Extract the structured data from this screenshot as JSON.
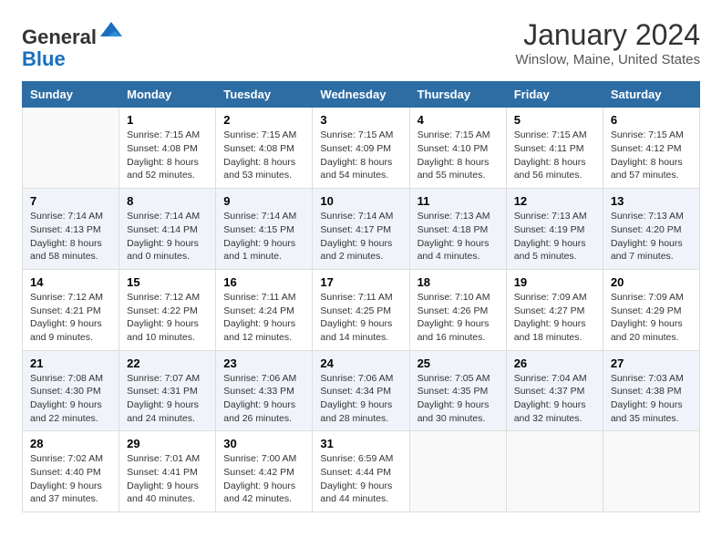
{
  "header": {
    "logo_general": "General",
    "logo_blue": "Blue",
    "month_title": "January 2024",
    "location": "Winslow, Maine, United States"
  },
  "days_of_week": [
    "Sunday",
    "Monday",
    "Tuesday",
    "Wednesday",
    "Thursday",
    "Friday",
    "Saturday"
  ],
  "weeks": [
    [
      {
        "day": "",
        "sunrise": "",
        "sunset": "",
        "daylight": ""
      },
      {
        "day": "1",
        "sunrise": "Sunrise: 7:15 AM",
        "sunset": "Sunset: 4:08 PM",
        "daylight": "Daylight: 8 hours and 52 minutes."
      },
      {
        "day": "2",
        "sunrise": "Sunrise: 7:15 AM",
        "sunset": "Sunset: 4:08 PM",
        "daylight": "Daylight: 8 hours and 53 minutes."
      },
      {
        "day": "3",
        "sunrise": "Sunrise: 7:15 AM",
        "sunset": "Sunset: 4:09 PM",
        "daylight": "Daylight: 8 hours and 54 minutes."
      },
      {
        "day": "4",
        "sunrise": "Sunrise: 7:15 AM",
        "sunset": "Sunset: 4:10 PM",
        "daylight": "Daylight: 8 hours and 55 minutes."
      },
      {
        "day": "5",
        "sunrise": "Sunrise: 7:15 AM",
        "sunset": "Sunset: 4:11 PM",
        "daylight": "Daylight: 8 hours and 56 minutes."
      },
      {
        "day": "6",
        "sunrise": "Sunrise: 7:15 AM",
        "sunset": "Sunset: 4:12 PM",
        "daylight": "Daylight: 8 hours and 57 minutes."
      }
    ],
    [
      {
        "day": "7",
        "sunrise": "Sunrise: 7:14 AM",
        "sunset": "Sunset: 4:13 PM",
        "daylight": "Daylight: 8 hours and 58 minutes."
      },
      {
        "day": "8",
        "sunrise": "Sunrise: 7:14 AM",
        "sunset": "Sunset: 4:14 PM",
        "daylight": "Daylight: 9 hours and 0 minutes."
      },
      {
        "day": "9",
        "sunrise": "Sunrise: 7:14 AM",
        "sunset": "Sunset: 4:15 PM",
        "daylight": "Daylight: 9 hours and 1 minute."
      },
      {
        "day": "10",
        "sunrise": "Sunrise: 7:14 AM",
        "sunset": "Sunset: 4:17 PM",
        "daylight": "Daylight: 9 hours and 2 minutes."
      },
      {
        "day": "11",
        "sunrise": "Sunrise: 7:13 AM",
        "sunset": "Sunset: 4:18 PM",
        "daylight": "Daylight: 9 hours and 4 minutes."
      },
      {
        "day": "12",
        "sunrise": "Sunrise: 7:13 AM",
        "sunset": "Sunset: 4:19 PM",
        "daylight": "Daylight: 9 hours and 5 minutes."
      },
      {
        "day": "13",
        "sunrise": "Sunrise: 7:13 AM",
        "sunset": "Sunset: 4:20 PM",
        "daylight": "Daylight: 9 hours and 7 minutes."
      }
    ],
    [
      {
        "day": "14",
        "sunrise": "Sunrise: 7:12 AM",
        "sunset": "Sunset: 4:21 PM",
        "daylight": "Daylight: 9 hours and 9 minutes."
      },
      {
        "day": "15",
        "sunrise": "Sunrise: 7:12 AM",
        "sunset": "Sunset: 4:22 PM",
        "daylight": "Daylight: 9 hours and 10 minutes."
      },
      {
        "day": "16",
        "sunrise": "Sunrise: 7:11 AM",
        "sunset": "Sunset: 4:24 PM",
        "daylight": "Daylight: 9 hours and 12 minutes."
      },
      {
        "day": "17",
        "sunrise": "Sunrise: 7:11 AM",
        "sunset": "Sunset: 4:25 PM",
        "daylight": "Daylight: 9 hours and 14 minutes."
      },
      {
        "day": "18",
        "sunrise": "Sunrise: 7:10 AM",
        "sunset": "Sunset: 4:26 PM",
        "daylight": "Daylight: 9 hours and 16 minutes."
      },
      {
        "day": "19",
        "sunrise": "Sunrise: 7:09 AM",
        "sunset": "Sunset: 4:27 PM",
        "daylight": "Daylight: 9 hours and 18 minutes."
      },
      {
        "day": "20",
        "sunrise": "Sunrise: 7:09 AM",
        "sunset": "Sunset: 4:29 PM",
        "daylight": "Daylight: 9 hours and 20 minutes."
      }
    ],
    [
      {
        "day": "21",
        "sunrise": "Sunrise: 7:08 AM",
        "sunset": "Sunset: 4:30 PM",
        "daylight": "Daylight: 9 hours and 22 minutes."
      },
      {
        "day": "22",
        "sunrise": "Sunrise: 7:07 AM",
        "sunset": "Sunset: 4:31 PM",
        "daylight": "Daylight: 9 hours and 24 minutes."
      },
      {
        "day": "23",
        "sunrise": "Sunrise: 7:06 AM",
        "sunset": "Sunset: 4:33 PM",
        "daylight": "Daylight: 9 hours and 26 minutes."
      },
      {
        "day": "24",
        "sunrise": "Sunrise: 7:06 AM",
        "sunset": "Sunset: 4:34 PM",
        "daylight": "Daylight: 9 hours and 28 minutes."
      },
      {
        "day": "25",
        "sunrise": "Sunrise: 7:05 AM",
        "sunset": "Sunset: 4:35 PM",
        "daylight": "Daylight: 9 hours and 30 minutes."
      },
      {
        "day": "26",
        "sunrise": "Sunrise: 7:04 AM",
        "sunset": "Sunset: 4:37 PM",
        "daylight": "Daylight: 9 hours and 32 minutes."
      },
      {
        "day": "27",
        "sunrise": "Sunrise: 7:03 AM",
        "sunset": "Sunset: 4:38 PM",
        "daylight": "Daylight: 9 hours and 35 minutes."
      }
    ],
    [
      {
        "day": "28",
        "sunrise": "Sunrise: 7:02 AM",
        "sunset": "Sunset: 4:40 PM",
        "daylight": "Daylight: 9 hours and 37 minutes."
      },
      {
        "day": "29",
        "sunrise": "Sunrise: 7:01 AM",
        "sunset": "Sunset: 4:41 PM",
        "daylight": "Daylight: 9 hours and 40 minutes."
      },
      {
        "day": "30",
        "sunrise": "Sunrise: 7:00 AM",
        "sunset": "Sunset: 4:42 PM",
        "daylight": "Daylight: 9 hours and 42 minutes."
      },
      {
        "day": "31",
        "sunrise": "Sunrise: 6:59 AM",
        "sunset": "Sunset: 4:44 PM",
        "daylight": "Daylight: 9 hours and 44 minutes."
      },
      {
        "day": "",
        "sunrise": "",
        "sunset": "",
        "daylight": ""
      },
      {
        "day": "",
        "sunrise": "",
        "sunset": "",
        "daylight": ""
      },
      {
        "day": "",
        "sunrise": "",
        "sunset": "",
        "daylight": ""
      }
    ]
  ]
}
